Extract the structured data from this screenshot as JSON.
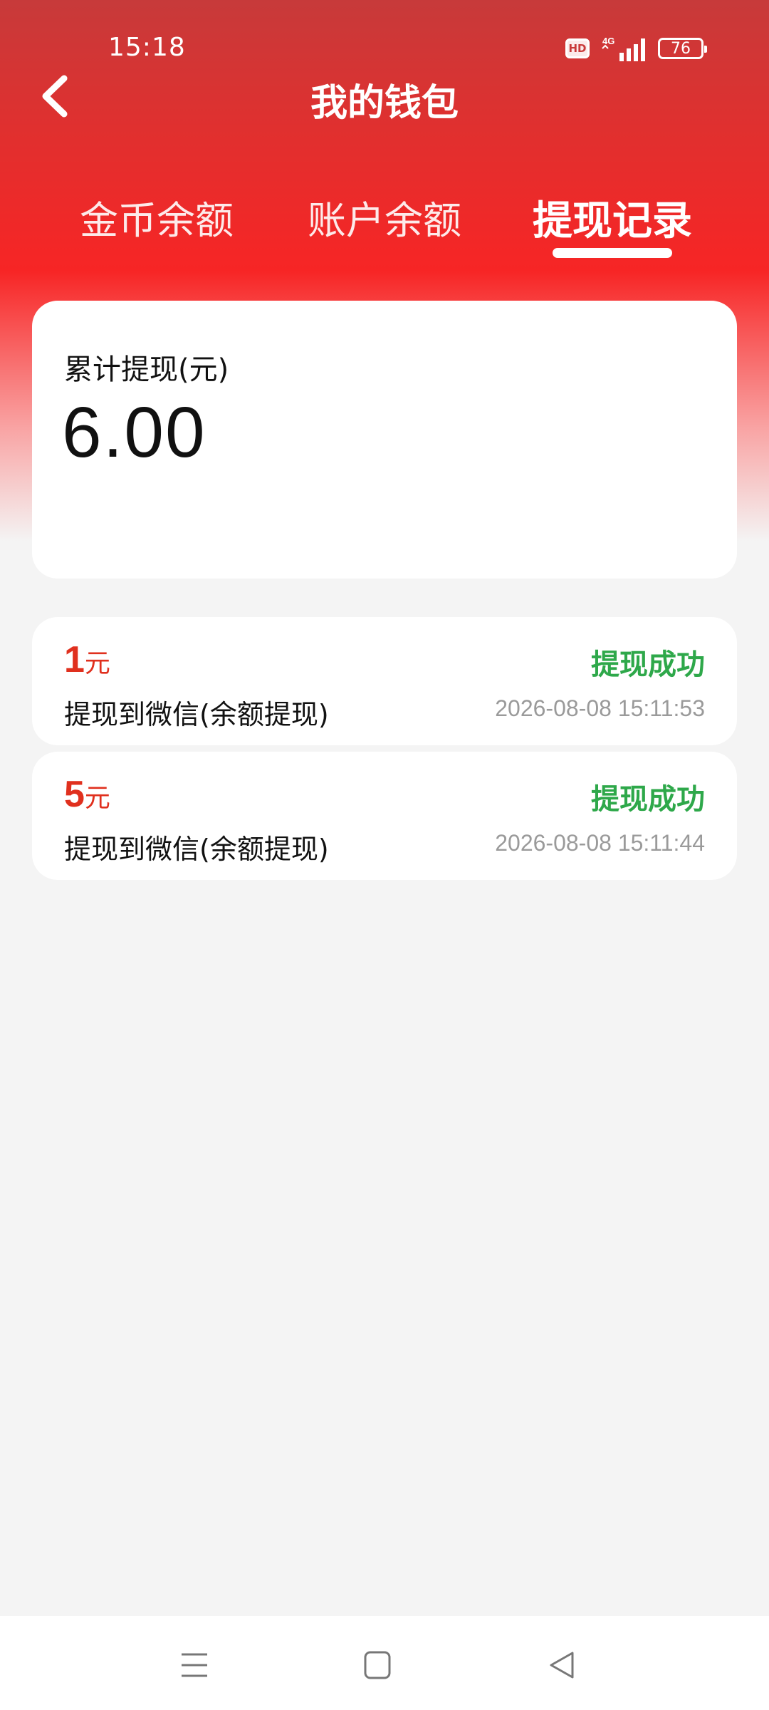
{
  "status_bar": {
    "time": "15:18",
    "hd_label": "HD",
    "network_label": "4G",
    "battery": "76"
  },
  "header": {
    "title": "我的钱包",
    "back_icon": "chevron-left-icon"
  },
  "tabs": [
    {
      "label": "金币余额",
      "active": false
    },
    {
      "label": "账户余额",
      "active": false
    },
    {
      "label": "提现记录",
      "active": true
    }
  ],
  "summary": {
    "label": "累计提现(元)",
    "value": "6.00"
  },
  "records": [
    {
      "amount": "1",
      "unit": "元",
      "status": "提现成功",
      "description": "提现到微信(余额提现)",
      "time": "2026-08-08 15:11:53"
    },
    {
      "amount": "5",
      "unit": "元",
      "status": "提现成功",
      "description": "提现到微信(余额提现)",
      "time": "2026-08-08 15:11:44"
    }
  ],
  "colors": {
    "header_red": "#f72525",
    "amount_red": "#e0301e",
    "status_green": "#2ea84a",
    "time_gray": "#9a9a9a"
  },
  "nav_bar": {
    "icons": [
      "menu-icon",
      "home-square-icon",
      "back-triangle-icon"
    ]
  }
}
